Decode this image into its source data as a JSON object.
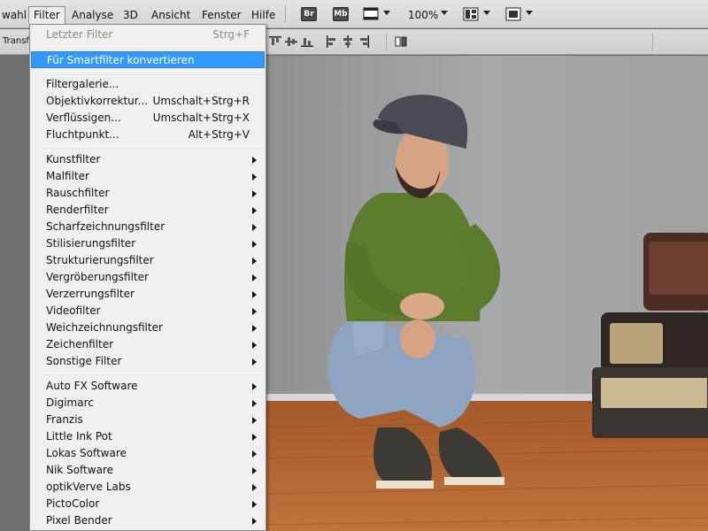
{
  "menubar": {
    "items": [
      "wahl",
      "Filter",
      "Analyse",
      "3D",
      "Ansicht",
      "Fenster",
      "Hilfe"
    ],
    "bridge_label": "Br",
    "minibridge_label": "Mb",
    "zoom": "100%"
  },
  "options": {
    "tool_label": "Transf"
  },
  "filter_menu": {
    "groups": [
      [
        {
          "label": "Letzter Filter",
          "shortcut": "Strg+F",
          "disabled": true
        }
      ],
      [
        {
          "label": "Für Smartfilter konvertieren",
          "highlighted": true
        }
      ],
      [
        {
          "label": "Filtergalerie..."
        },
        {
          "label": "Objektivkorrektur...",
          "shortcut": "Umschalt+Strg+R"
        },
        {
          "label": "Verflüssigen...",
          "shortcut": "Umschalt+Strg+X"
        },
        {
          "label": "Fluchtpunkt...",
          "shortcut": "Alt+Strg+V"
        }
      ],
      [
        {
          "label": "Kunstfilter",
          "submenu": true
        },
        {
          "label": "Malfilter",
          "submenu": true
        },
        {
          "label": "Rauschfilter",
          "submenu": true
        },
        {
          "label": "Renderfilter",
          "submenu": true
        },
        {
          "label": "Scharfzeichnungsfilter",
          "submenu": true
        },
        {
          "label": "Stilisierungsfilter",
          "submenu": true
        },
        {
          "label": "Strukturierungsfilter",
          "submenu": true
        },
        {
          "label": "Vergröberungsfilter",
          "submenu": true
        },
        {
          "label": "Verzerrungsfilter",
          "submenu": true
        },
        {
          "label": "Videofilter",
          "submenu": true
        },
        {
          "label": "Weichzeichnungsfilter",
          "submenu": true
        },
        {
          "label": "Zeichenfilter",
          "submenu": true
        },
        {
          "label": "Sonstige Filter",
          "submenu": true
        }
      ],
      [
        {
          "label": "Auto FX Software",
          "submenu": true
        },
        {
          "label": "Digimarc",
          "submenu": true
        },
        {
          "label": "Franzis",
          "submenu": true
        },
        {
          "label": "Little Ink Pot",
          "submenu": true
        },
        {
          "label": "Lokas Software",
          "submenu": true
        },
        {
          "label": "Nik Software",
          "submenu": true
        },
        {
          "label": "optikVerve Labs",
          "submenu": true
        },
        {
          "label": "PictoColor",
          "submenu": true
        },
        {
          "label": "Pixel Bender",
          "submenu": true
        }
      ]
    ]
  },
  "colors": {
    "highlight": "#3399ff",
    "menu_bg": "#f0f0f0",
    "wall": "#a3a5a7",
    "floor": "#b8642a",
    "shirt": "#5d7d2e",
    "jeans": "#8fa6c4",
    "cap": "#4a4a55"
  }
}
